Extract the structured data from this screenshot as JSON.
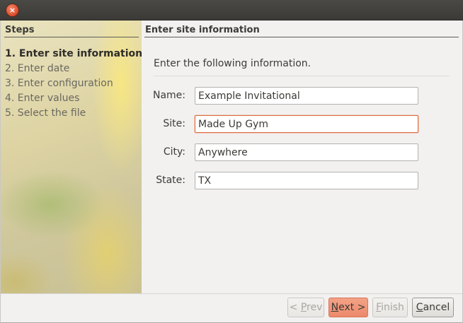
{
  "window": {
    "close_glyph": "×"
  },
  "sidebar": {
    "title": "Steps",
    "steps": [
      {
        "label": "1. Enter site information",
        "active": true
      },
      {
        "label": "2. Enter date",
        "active": false
      },
      {
        "label": "3. Enter configuration",
        "active": false
      },
      {
        "label": "4. Enter values",
        "active": false
      },
      {
        "label": "5. Select the file",
        "active": false
      }
    ]
  },
  "content": {
    "title": "Enter site information",
    "instruction": "Enter the following information.",
    "fields": {
      "name": {
        "label": "Name:",
        "value": "Example Invitational"
      },
      "site": {
        "label": "Site:",
        "value": "Made Up Gym"
      },
      "city": {
        "label": "City:",
        "value": "Anywhere"
      },
      "state": {
        "label": "State:",
        "value": "TX"
      }
    }
  },
  "buttons": {
    "prev": {
      "mnemonic": "P",
      "rest": "rev",
      "prefix": "< "
    },
    "next": {
      "mnemonic": "N",
      "rest": "ext >"
    },
    "finish": {
      "mnemonic": "F",
      "rest": "inish"
    },
    "cancel": {
      "mnemonic": "C",
      "rest": "ancel"
    }
  },
  "colors": {
    "accent": "#e06b3c",
    "primary_button": "#ec8a6b"
  }
}
